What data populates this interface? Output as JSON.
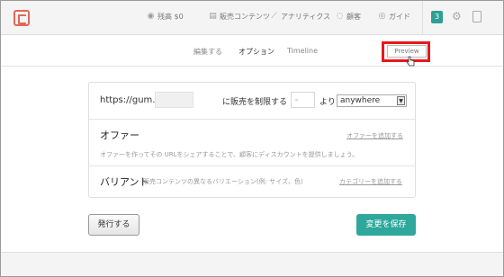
{
  "header": {
    "nav": [
      {
        "icon": "wallet-icon",
        "glyph": "◉",
        "label": "残高 $0"
      },
      {
        "icon": "product-icon",
        "glyph": "▤",
        "label": "販売コンテンツ"
      },
      {
        "icon": "analytics-icon",
        "glyph": "⟋",
        "label": "アナリティクス"
      },
      {
        "icon": "customers-icon",
        "glyph": "◌",
        "label": "顧客"
      },
      {
        "icon": "guide-icon",
        "glyph": "◎",
        "label": "ガイド"
      }
    ],
    "notification_count": "3"
  },
  "tabs": {
    "edit": "編集する",
    "options": "オプション",
    "timeline": "Timeline",
    "preview": "Preview"
  },
  "url_row": {
    "url_prefix": "https://gum.co/",
    "limit_label": "に販売を制限する",
    "count_placeholder": "∞",
    "from_label": "より",
    "location_value": "anywhere"
  },
  "offer": {
    "title": "オファー",
    "add_link": "オファーを追加する",
    "description": "オファーを作ってその URLをシェアすることで、顧客にディスカウントを提供しましょう。"
  },
  "variant": {
    "title": "バリアント",
    "description": "販売コンテンツの異なるバリエーション(例: サイズ、色)",
    "add_link": "カテゴリーを追加する"
  },
  "actions": {
    "publish": "発行する",
    "save": "変更を保存"
  },
  "colors": {
    "accent": "#2ea79c",
    "highlight": "#e8181d",
    "logo": "#e0685a"
  }
}
